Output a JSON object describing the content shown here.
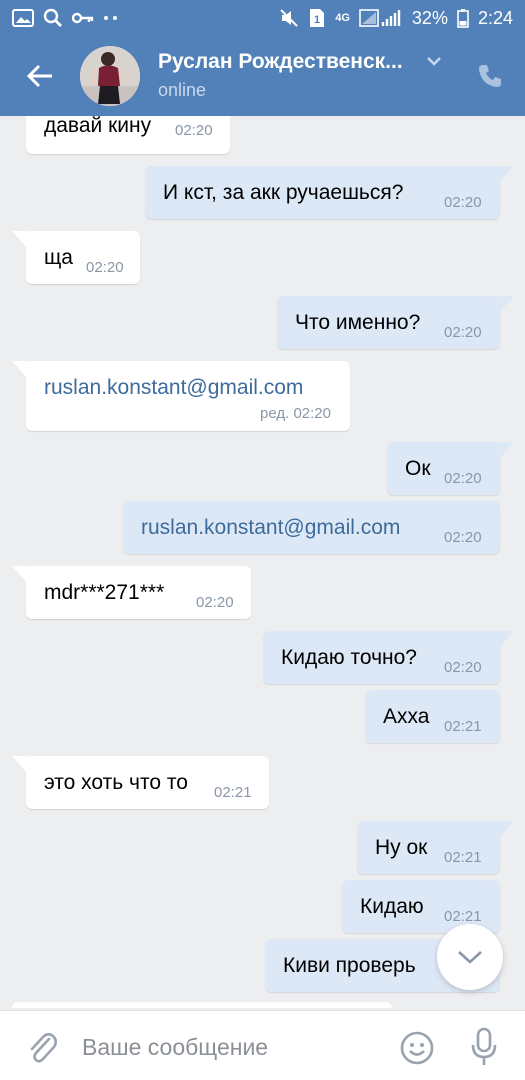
{
  "status_bar": {
    "battery": "32%",
    "time": "2:24",
    "network": "4G",
    "sim": "1"
  },
  "header": {
    "title": "Руслан Рождественск...",
    "subtitle": "online"
  },
  "messages": [
    {
      "dir": "in",
      "text": "давай кину",
      "time": "02:20"
    },
    {
      "dir": "out",
      "text": "И кст, за акк ручаешься?",
      "time": "02:20"
    },
    {
      "dir": "in",
      "text": "ща",
      "time": "02:20"
    },
    {
      "dir": "out",
      "text": "Что именно?",
      "time": "02:20"
    },
    {
      "dir": "in",
      "text": "ruslan.konstant@gmail.com",
      "time": "ред. 02:20",
      "link": true
    },
    {
      "dir": "out",
      "text": "Ок",
      "time": "02:20"
    },
    {
      "dir": "out",
      "text": "ruslan.konstant@gmail.com",
      "time": "02:20",
      "link": true
    },
    {
      "dir": "in",
      "text": "mdr***271***",
      "time": "02:20"
    },
    {
      "dir": "out",
      "text": "Кидаю точно?",
      "time": "02:20"
    },
    {
      "dir": "out",
      "text": "Ахха",
      "time": "02:21"
    },
    {
      "dir": "in",
      "text": "это хоть что то",
      "time": "02:21"
    },
    {
      "dir": "out",
      "text": "Ну ок",
      "time": "02:21"
    },
    {
      "dir": "out",
      "text": "Кидаю",
      "time": "02:21"
    },
    {
      "dir": "out",
      "text": "Киви проверь",
      "time": ""
    }
  ],
  "composer": {
    "placeholder": "Ваше сообщение"
  },
  "colors": {
    "header": "#5181b8",
    "incoming": "#ffffff",
    "outgoing": "#dde8f6",
    "background": "#edeef0",
    "link": "#3e6b9c"
  },
  "icons": [
    "image-icon",
    "search-icon",
    "key-icon",
    "more-dots-icon",
    "mute-icon",
    "sim-icon",
    "signal-icon",
    "battery-icon",
    "back-arrow-icon",
    "chevron-down-icon",
    "phone-icon",
    "chevron-down-icon",
    "paperclip-icon",
    "emoji-icon",
    "microphone-icon"
  ]
}
